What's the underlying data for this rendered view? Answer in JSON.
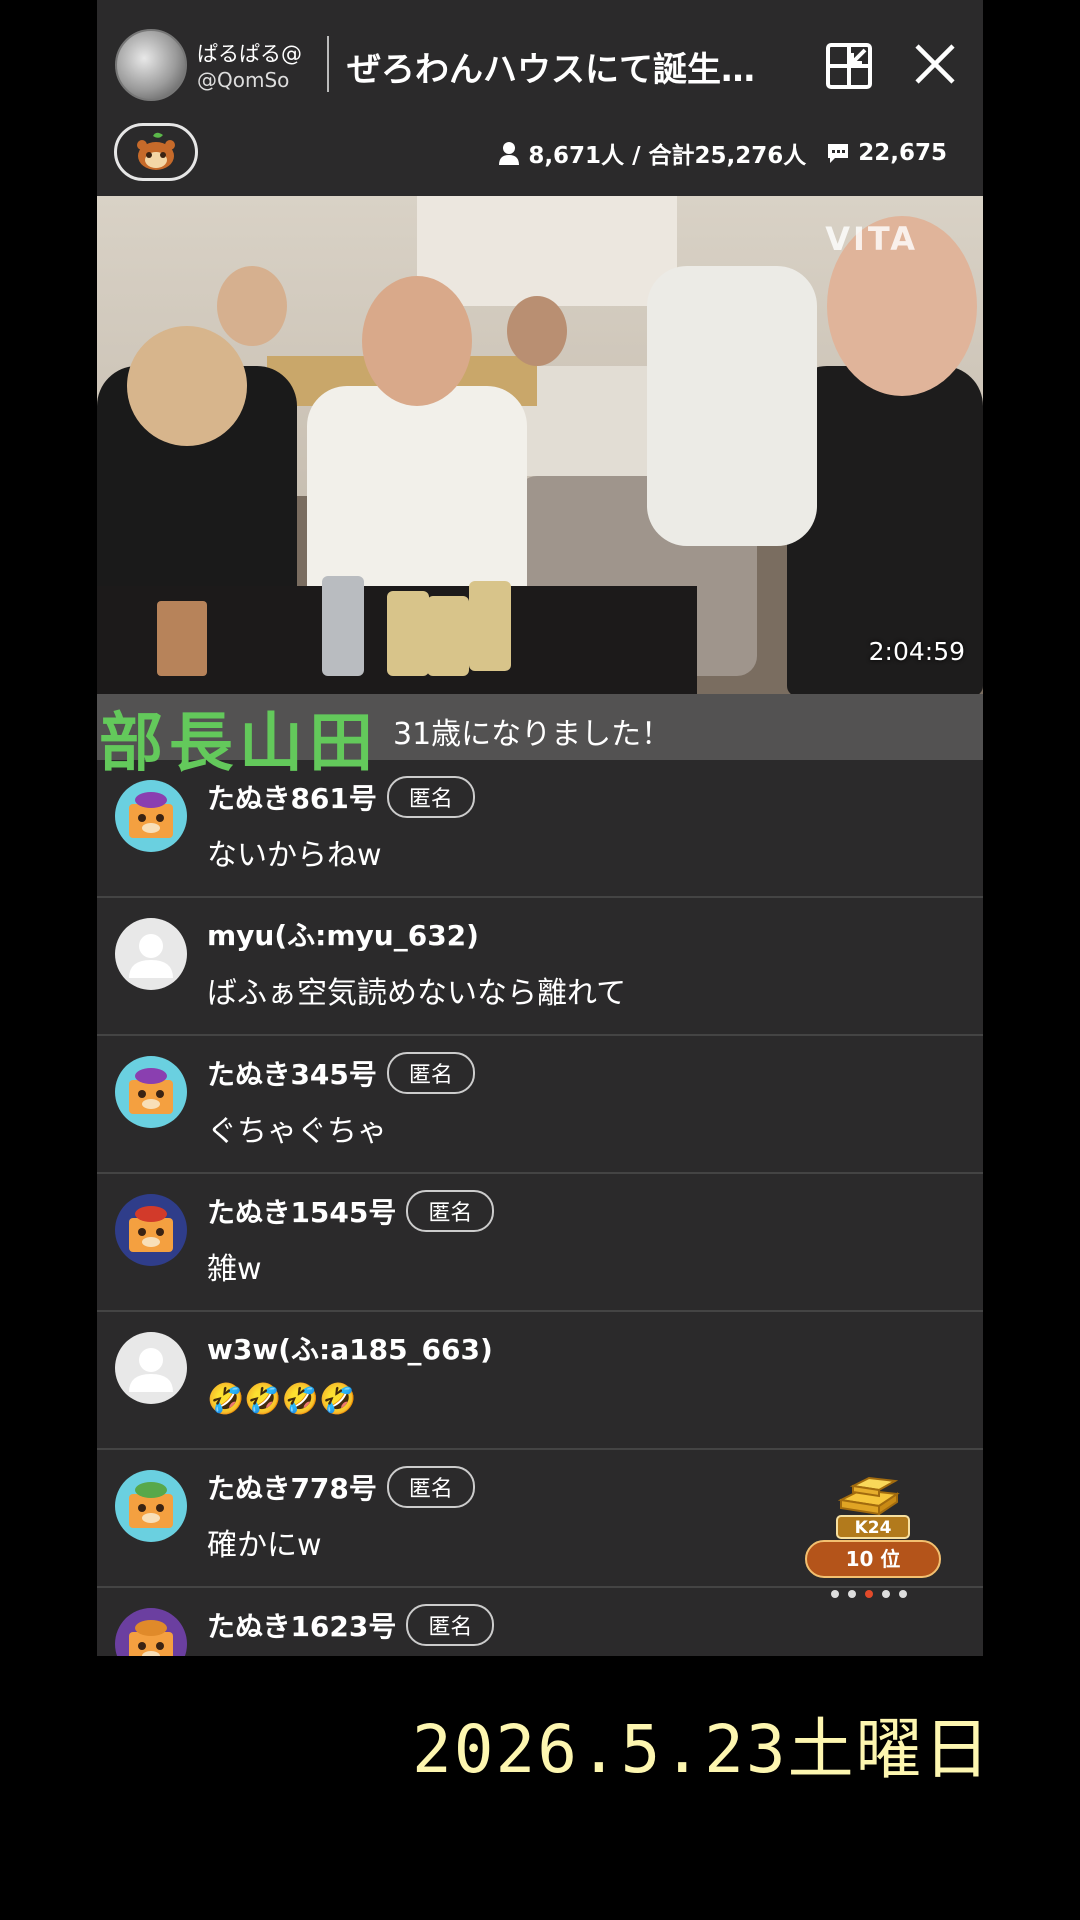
{
  "header": {
    "host_name": "ぱるぱる@",
    "host_handle": "@QomSo",
    "title": "ぜろわんハウスにて誕生…",
    "viewers": "8,671人 / 合計25,276人",
    "comments_count": "22,675"
  },
  "video": {
    "watermark": "VITA",
    "timecode": "2:04:59"
  },
  "caption": {
    "name": "部長山田",
    "text": "31歳になりました！"
  },
  "comments": [
    {
      "name": "たぬき861号",
      "tag": "匿名",
      "text": "ないからねw",
      "avatar": "tanuki-purple"
    },
    {
      "name": "myu(ふ:myu_632)",
      "tag": "",
      "text": "ばふぁ空気読めないなら離れて",
      "avatar": "default"
    },
    {
      "name": "たぬき345号",
      "tag": "匿名",
      "text": "ぐちゃぐちゃ",
      "avatar": "tanuki-purple"
    },
    {
      "name": "たぬき1545号",
      "tag": "匿名",
      "text": "雑w",
      "avatar": "tanuki-red"
    },
    {
      "name": "w3w(ふ:a185_663)",
      "tag": "",
      "text": "🤣🤣🤣🤣",
      "avatar": "default"
    },
    {
      "name": "たぬき778号",
      "tag": "匿名",
      "text": "確かにw",
      "avatar": "tanuki-green"
    },
    {
      "name": "たぬき1623号",
      "tag": "匿名",
      "text": "",
      "avatar": "tanuki-orange"
    }
  ],
  "rank": {
    "label": "K24",
    "position": "10 位"
  },
  "date_stamp": "2026.5.23土曜日"
}
